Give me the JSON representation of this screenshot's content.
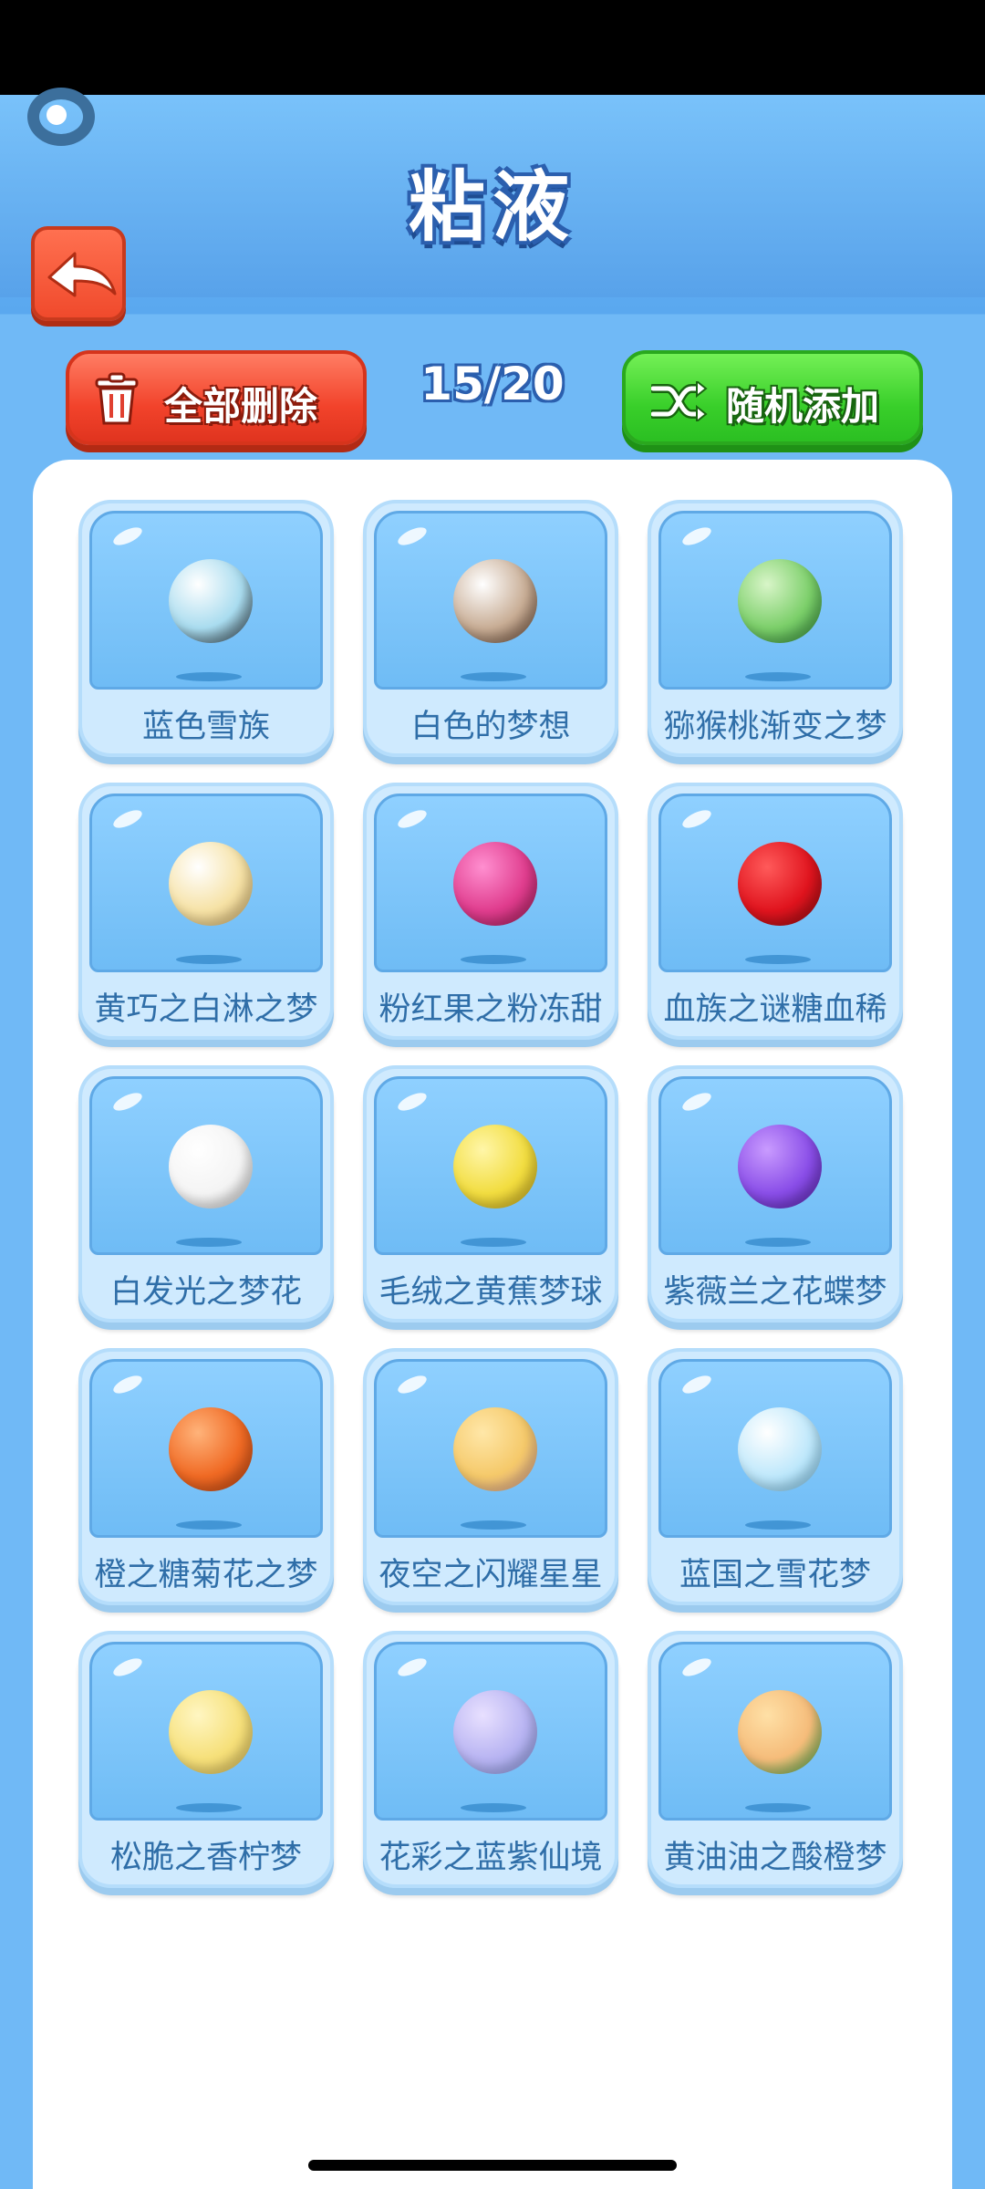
{
  "header": {
    "title": "粘液"
  },
  "toolbar": {
    "delete_all_label": "全部删除",
    "counter": "15/20",
    "random_add_label": "随机添加"
  },
  "items": [
    {
      "label": "蓝色雪族",
      "colors": [
        "#ffffff",
        "#a9dcef",
        "#2e3b44"
      ]
    },
    {
      "label": "白色的梦想",
      "colors": [
        "#ffffff",
        "#c8ad95",
        "#6b4a36"
      ]
    },
    {
      "label": "猕猴桃渐变之梦",
      "colors": [
        "#d8f5c8",
        "#7ccf6a",
        "#2f8e3a"
      ]
    },
    {
      "label": "黄巧之白淋之梦",
      "colors": [
        "#ffffff",
        "#f6e2a6",
        "#d7b36a"
      ]
    },
    {
      "label": "粉红果之粉冻甜",
      "colors": [
        "#ff8fd0",
        "#e03d8e",
        "#a81d5a"
      ]
    },
    {
      "label": "血族之谜糖血稀",
      "colors": [
        "#ff5a5a",
        "#e0141e",
        "#9a0a10"
      ]
    },
    {
      "label": "白发光之梦花",
      "colors": [
        "#ffffff",
        "#f4f4f4",
        "#cccccc"
      ]
    },
    {
      "label": "毛绒之黄蕉梦球",
      "colors": [
        "#fff6a8",
        "#f2dd40",
        "#c9a91a"
      ]
    },
    {
      "label": "紫薇兰之花蝶梦",
      "colors": [
        "#c99bff",
        "#8a4ee8",
        "#5a24b0"
      ]
    },
    {
      "label": "橙之糖菊花之梦",
      "colors": [
        "#ffb37a",
        "#f06a24",
        "#c24510"
      ]
    },
    {
      "label": "夜空之闪耀星星",
      "colors": [
        "#ffe7a8",
        "#f5c96a",
        "#e0a6a0"
      ]
    },
    {
      "label": "蓝国之雪花梦",
      "colors": [
        "#ffffff",
        "#bfe8fb",
        "#7cc8ee"
      ]
    },
    {
      "label": "松脆之香柠梦",
      "colors": [
        "#fff6c2",
        "#f6e07a",
        "#e0c25a"
      ]
    },
    {
      "label": "花彩之蓝紫仙境",
      "colors": [
        "#e8e0ff",
        "#b8b4f2",
        "#8f9ee8"
      ]
    },
    {
      "label": "黄油油之酸橙梦",
      "colors": [
        "#ffe0a6",
        "#f5bc7a",
        "#3fb34a"
      ]
    }
  ]
}
